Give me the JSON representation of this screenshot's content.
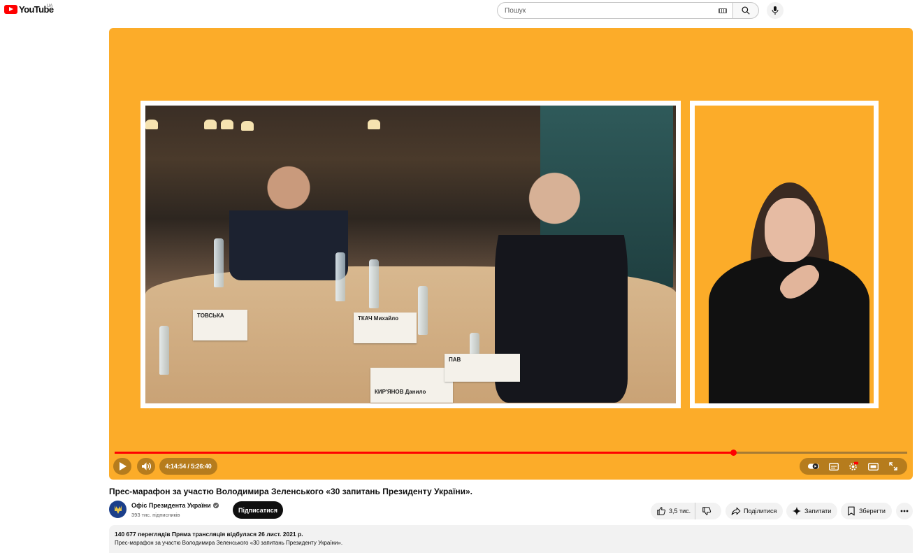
{
  "header": {
    "logo_text": "YouTube",
    "country_code": "UA",
    "search_placeholder": "Пошук"
  },
  "player": {
    "current_time": "4:14:54",
    "duration": "5:26:40",
    "time_display": "4:14:54 / 5:26:40",
    "progress_fraction": 0.78,
    "background_color": "#fcac29",
    "scene_labels": [
      "ТКАЧ Михайло",
      "КИР'ЯНОВ Данило",
      "ТОВСЬКА",
      "ПАВ"
    ]
  },
  "video": {
    "title": "Прес-марафон за участю Володимира Зеленського «30 запитань Президенту України».",
    "channel_name": "Офіс Президента України",
    "subscribers": "393 тис. підписників",
    "subscribe_label": "Підписатися",
    "like_count": "3,5 тис.",
    "share_label": "Поділитися",
    "ask_label": "Запитати",
    "save_label": "Зберегти"
  },
  "description": {
    "meta": "140 677 переглядів  Пряма трансляція відбулася 26 лист. 2021 р.",
    "text": "Прес-марафон за участю Володимира Зеленського «30 запитань Президенту України»."
  },
  "icons": {
    "search": "search-icon",
    "mic": "mic-icon",
    "keyboard": "keyboard-icon",
    "play": "play-icon",
    "volume": "volume-icon",
    "autoplay": "autoplay-toggle-icon",
    "subtitles": "subtitles-icon",
    "settings": "settings-icon",
    "theater": "theater-mode-icon",
    "fullscreen": "fullscreen-icon",
    "like": "thumbs-up-icon",
    "dislike": "thumbs-down-icon",
    "share": "share-icon",
    "ask": "sparkle-icon",
    "save": "bookmark-icon",
    "more": "more-horiz-icon"
  },
  "colors": {
    "brand_red": "#ff0000",
    "player_orange": "#fcac29",
    "subscribe_bg": "#0f0f0f"
  }
}
